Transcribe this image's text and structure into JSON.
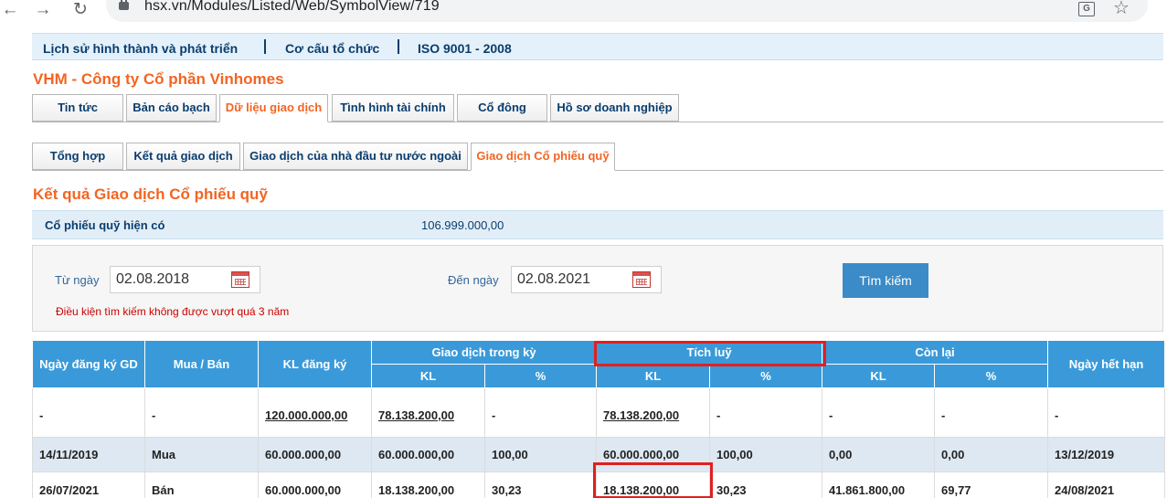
{
  "browser": {
    "back": "←",
    "forward": "→",
    "reload": "↻",
    "url": "hsx.vn/Modules/Listed/Web/SymbolView/719",
    "translate": "G",
    "bookmark": "☆"
  },
  "topbar": {
    "links": [
      "Lịch sử hình thành và phát triển",
      "Cơ cấu tổ chức",
      "ISO 9001 - 2008"
    ]
  },
  "company_title": "VHM - Công ty Cổ phần Vinhomes",
  "main_tabs": [
    "Tin tức",
    "Bản cáo bạch",
    "Dữ liệu giao dịch",
    "Tình hình tài chính",
    "Cổ đông",
    "Hồ sơ doanh nghiệp"
  ],
  "sub_tabs": [
    "Tổng hợp",
    "Kết quả giao dịch",
    "Giao dịch của nhà đầu tư nước ngoài",
    "Giao dịch Cổ phiếu quỹ"
  ],
  "section_title": "Kết quả Giao dịch Cổ phiếu quỹ",
  "fund": {
    "label": "Cổ phiếu quỹ hiện có",
    "value": "106.999.000,00"
  },
  "search": {
    "from_label": "Từ ngày",
    "from_value": "02.08.2018",
    "to_label": "Đến ngày",
    "to_value": "02.08.2021",
    "button": "Tìm kiếm",
    "note": "Điều kiện tìm kiếm không được vượt quá 3 năm"
  },
  "table": {
    "headers": {
      "date": "Ngày đăng ký GD",
      "side": "Mua / Bán",
      "registered": "KL đăng ký",
      "group_period": "Giao dịch trong kỳ",
      "group_cumulative": "Tích luỹ",
      "group_remaining": "Còn lại",
      "expiry": "Ngày hết hạn",
      "kl": "KL",
      "pct": "%"
    },
    "rows": [
      [
        "-",
        "-",
        "120.000.000,00",
        "78.138.200,00",
        "-",
        "78.138.200,00",
        "-",
        "-",
        "-",
        "-"
      ],
      [
        "14/11/2019",
        "Mua",
        "60.000.000,00",
        "60.000.000,00",
        "100,00",
        "60.000.000,00",
        "100,00",
        "0,00",
        "0,00",
        "13/12/2019"
      ],
      [
        "26/07/2021",
        "Bán",
        "60.000.000,00",
        "18.138.200,00",
        "30,23",
        "18.138.200,00",
        "30,23",
        "41.861.800,00",
        "69,77",
        "24/08/2021"
      ]
    ]
  },
  "colors": {
    "accent_orange": "#f26522",
    "header_blue": "#3a9ad9",
    "highlight_red": "#e02020"
  }
}
